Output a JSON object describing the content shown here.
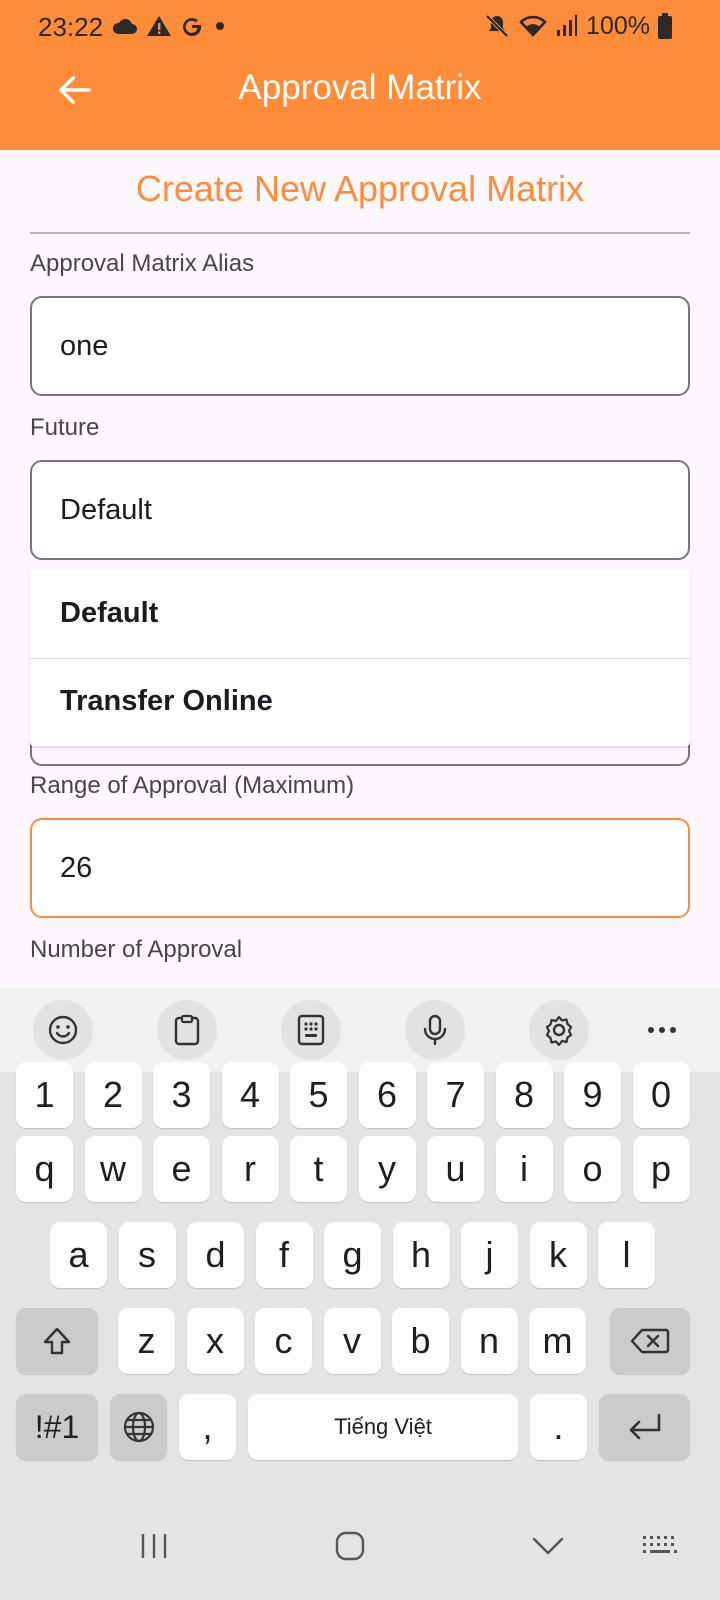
{
  "status_bar": {
    "time": "23:22",
    "battery": "100%",
    "icons": [
      "cloud-icon",
      "warning-icon",
      "google-icon",
      "dot-icon",
      "mute-icon",
      "wifi-icon",
      "signal-icon",
      "battery-icon"
    ]
  },
  "app_bar": {
    "title": "Approval Matrix",
    "back_icon": "arrow-left-icon",
    "color": "#ff8c38"
  },
  "form": {
    "heading": "Create New Approval Matrix",
    "alias": {
      "label": "Approval Matrix Alias",
      "value": "one"
    },
    "future": {
      "label": "Future",
      "value": "Default",
      "options": [
        "Default",
        "Transfer Online"
      ]
    },
    "range_max": {
      "label": "Range of Approval (Maximum)",
      "value": "26"
    },
    "number_of_approval": {
      "label": "Number of Approval"
    }
  },
  "keyboard": {
    "toolbar": [
      "emoji-icon",
      "clipboard-icon",
      "keypad-icon",
      "mic-icon",
      "settings-icon",
      "more-icon"
    ],
    "row_numbers": [
      "1",
      "2",
      "3",
      "4",
      "5",
      "6",
      "7",
      "8",
      "9",
      "0"
    ],
    "row_top": [
      "q",
      "w",
      "e",
      "r",
      "t",
      "y",
      "u",
      "i",
      "o",
      "p"
    ],
    "row_middle": [
      "a",
      "s",
      "d",
      "f",
      "g",
      "h",
      "j",
      "k",
      "l"
    ],
    "row_bottom": [
      "z",
      "x",
      "c",
      "v",
      "b",
      "n",
      "m"
    ],
    "symbols_key": "!#1",
    "comma_key": ",",
    "space_label": "Tiếng Việt",
    "period_key": "."
  },
  "nav_bar": [
    "recent-apps-icon",
    "home-icon",
    "back-chevron-icon",
    "keyboard-icon"
  ]
}
